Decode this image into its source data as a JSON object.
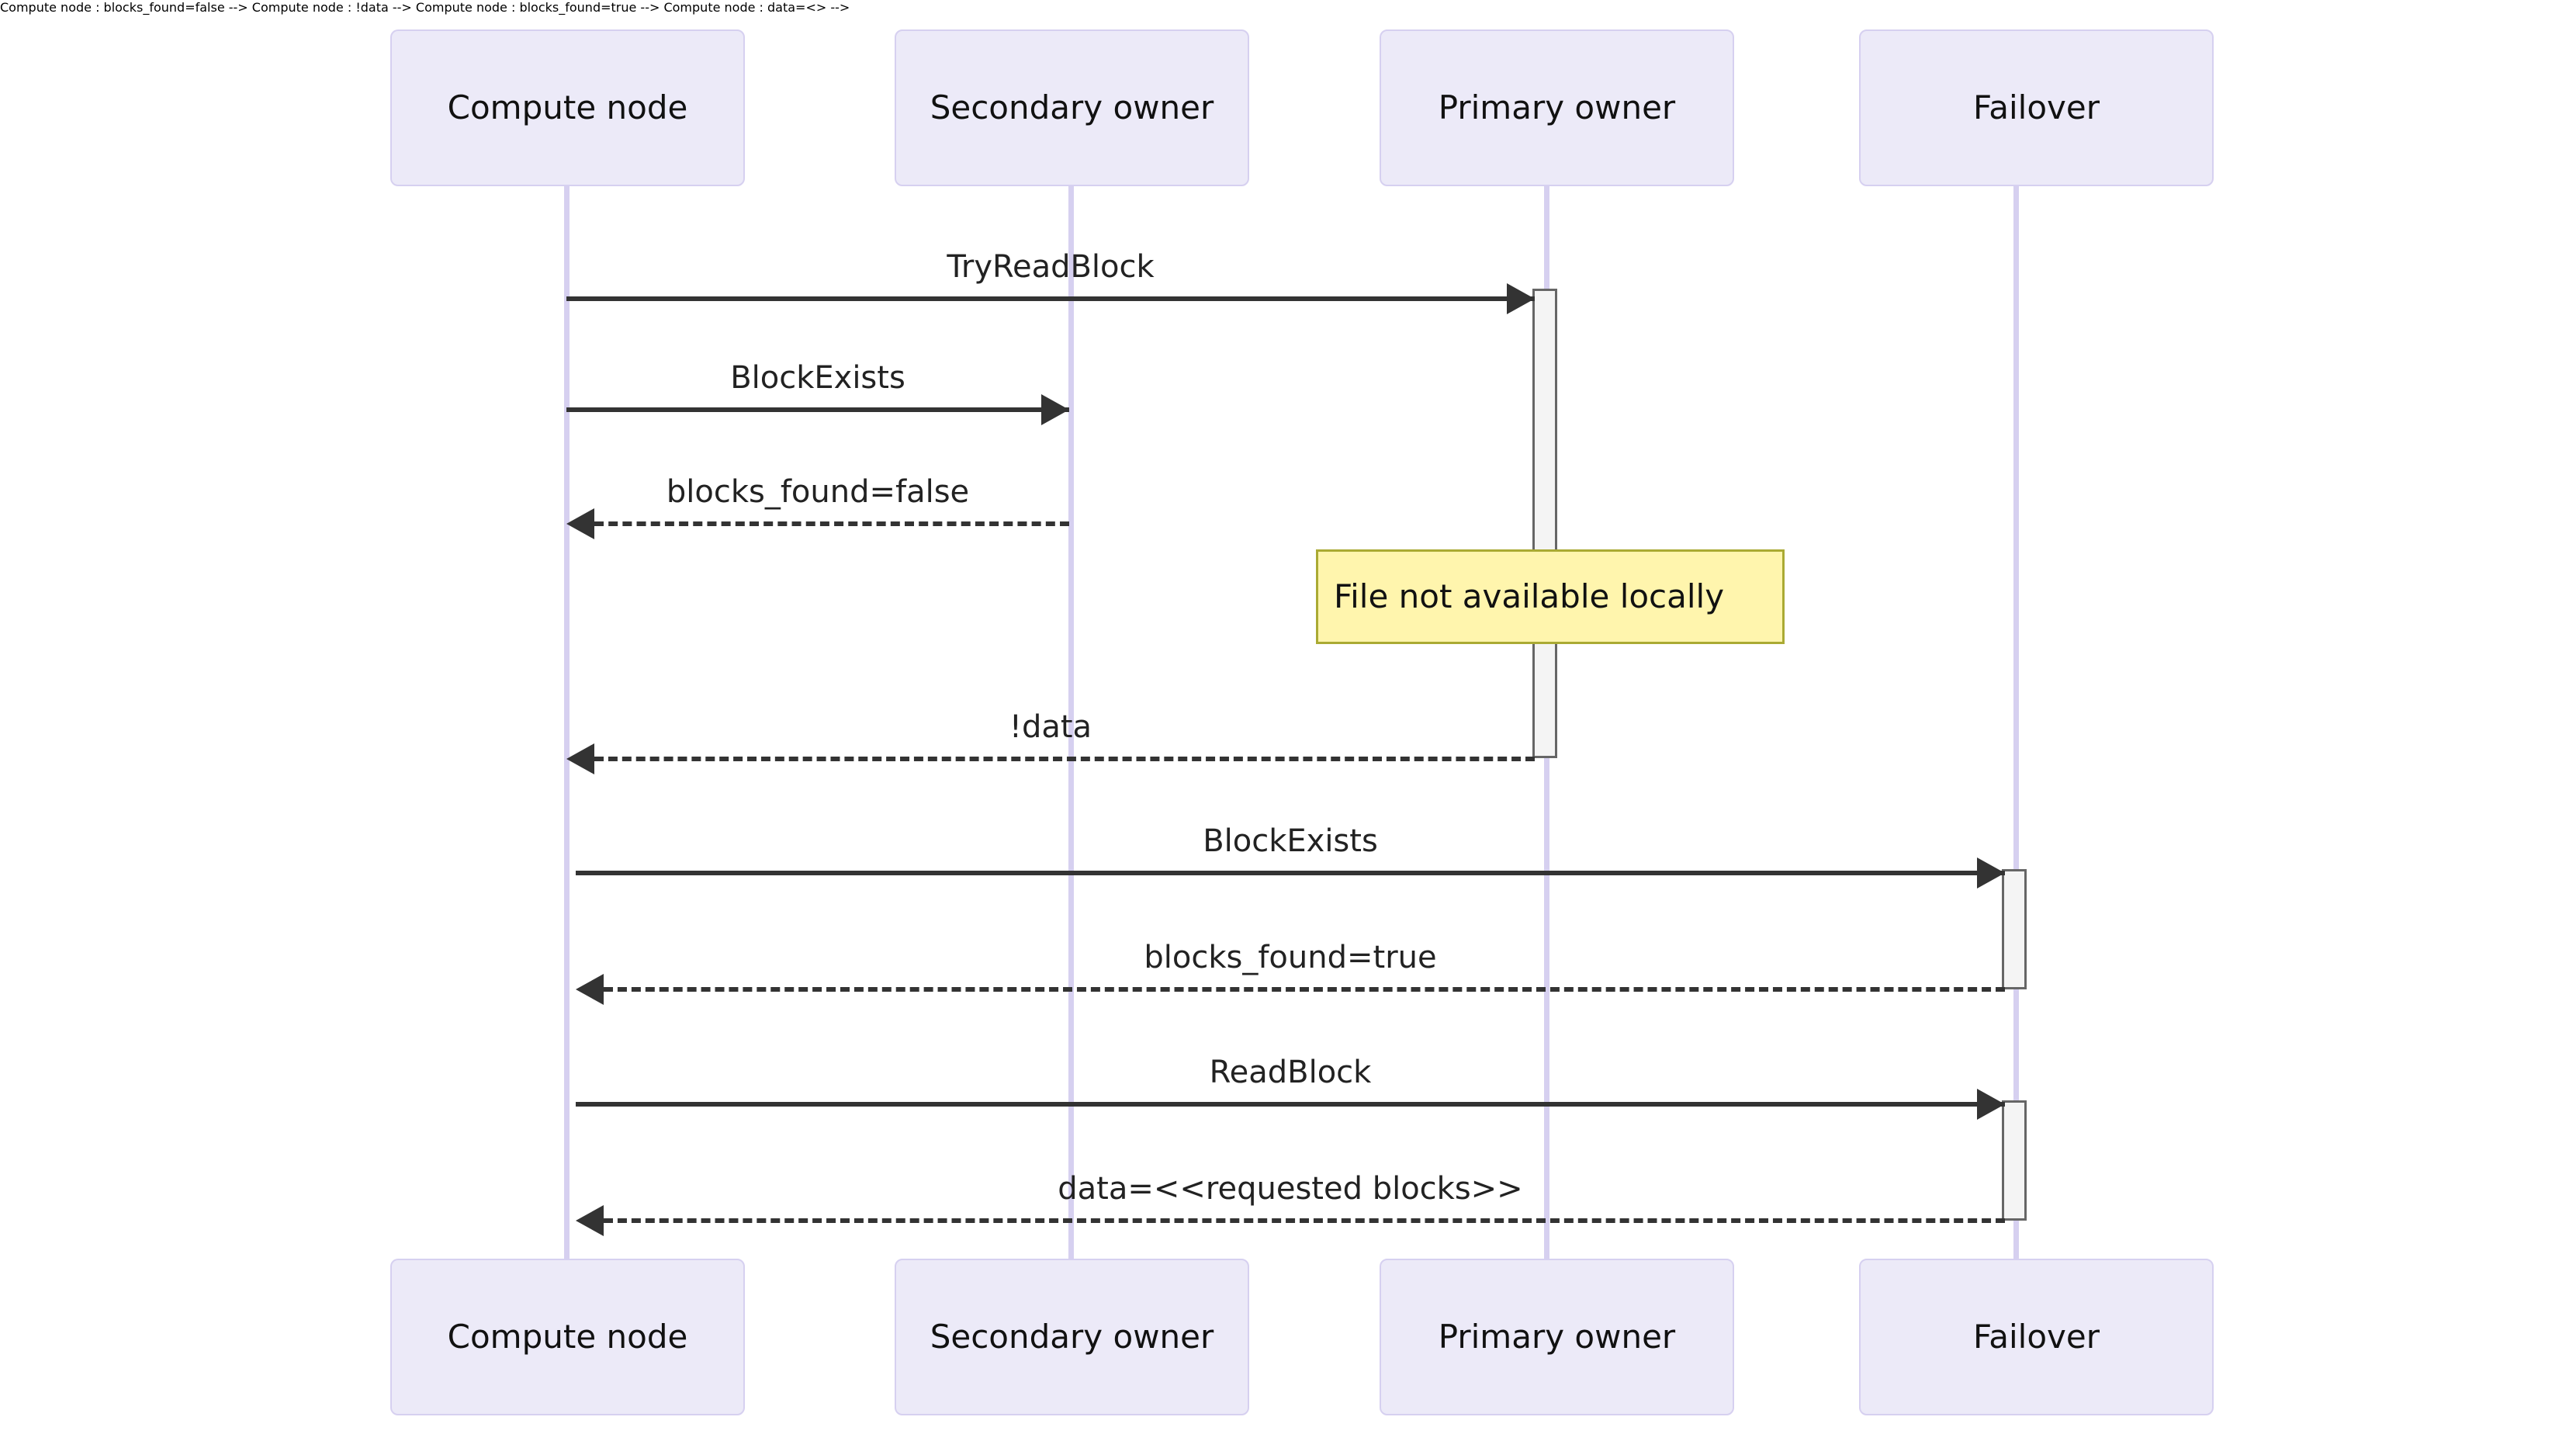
{
  "diagram": {
    "type": "sequence-diagram",
    "background_color": "#ffffff",
    "actor_fill": "#ECEAF8",
    "actor_border": "#D6D0F0",
    "lifeline_color": "#D6D0F0",
    "activation_fill": "#F4F4F4",
    "activation_border": "#666666",
    "note_fill": "#FFF5AD",
    "note_border": "#AAAA33",
    "arrow_color": "#333333"
  },
  "participants": [
    {
      "id": "compute",
      "label": "Compute node"
    },
    {
      "id": "secondary",
      "label": "Secondary owner"
    },
    {
      "id": "primary",
      "label": "Primary owner"
    },
    {
      "id": "failover",
      "label": "Failover"
    }
  ],
  "participants_bottom": [
    {
      "id": "compute",
      "label": "Compute node"
    },
    {
      "id": "secondary",
      "label": "Secondary owner"
    },
    {
      "id": "primary",
      "label": "Primary owner"
    },
    {
      "id": "failover",
      "label": "Failover"
    }
  ],
  "messages": [
    {
      "id": "m1",
      "label": "TryReadBlock",
      "from": "compute",
      "to": "primary",
      "kind": "call",
      "direction": "right"
    },
    {
      "id": "m2",
      "label": "BlockExists",
      "from": "compute",
      "to": "secondary",
      "kind": "call",
      "direction": "right"
    },
    {
      "id": "m3",
      "label": "blocks_found=false",
      "from": "secondary",
      "to": "compute",
      "kind": "return",
      "direction": "left"
    },
    {
      "id": "m4",
      "label": "!data",
      "from": "primary",
      "to": "compute",
      "kind": "return",
      "direction": "left"
    },
    {
      "id": "m5",
      "label": "BlockExists",
      "from": "compute",
      "to": "failover",
      "kind": "call",
      "direction": "right"
    },
    {
      "id": "m6",
      "label": "blocks_found=true",
      "from": "failover",
      "to": "compute",
      "kind": "return",
      "direction": "left"
    },
    {
      "id": "m7",
      "label": "ReadBlock",
      "from": "compute",
      "to": "failover",
      "kind": "call",
      "direction": "right"
    },
    {
      "id": "m8",
      "label": "data=<<requested blocks>>",
      "from": "failover",
      "to": "compute",
      "kind": "return",
      "direction": "left"
    }
  ],
  "notes": [
    {
      "id": "n1",
      "label": "File not available locally",
      "over": "primary"
    }
  ],
  "activations": [
    {
      "id": "a1",
      "over": "primary"
    },
    {
      "id": "a2",
      "over": "failover"
    },
    {
      "id": "a3",
      "over": "failover"
    }
  ]
}
